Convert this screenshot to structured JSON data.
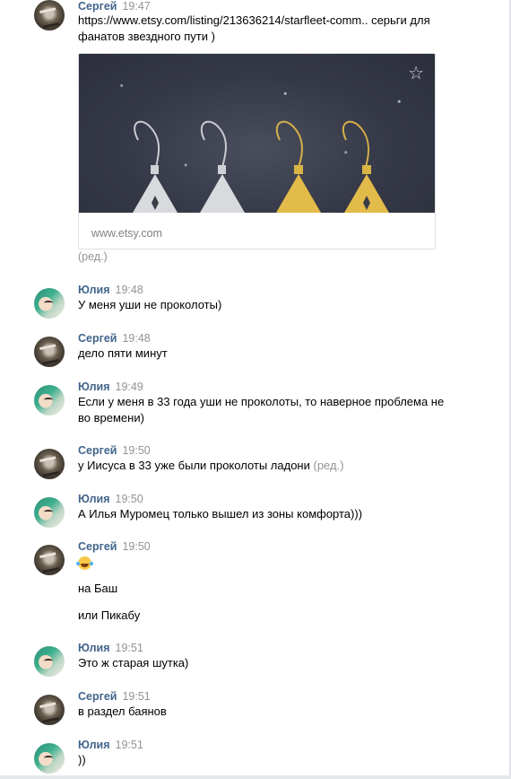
{
  "messages": [
    {
      "author": "Сергей",
      "time": "19:47",
      "lines": [
        "https://www.etsy.com/listing/213636214/starfleet-comm.. серьги для",
        "фанатов звездного пути )"
      ],
      "card": {
        "domain": "www.etsy.com",
        "icon": "star-outline-icon"
      },
      "edited": "(ред.)"
    },
    {
      "author": "Юлия",
      "time": "19:48",
      "lines": [
        "У меня уши не проколоты)"
      ]
    },
    {
      "author": "Сергей",
      "time": "19:48",
      "lines": [
        "дело пяти минут"
      ]
    },
    {
      "author": "Юлия",
      "time": "19:49",
      "lines": [
        "Если у меня в 33 года уши не проколоты, то наверное проблема не",
        "во времени)"
      ]
    },
    {
      "author": "Сергей",
      "time": "19:50",
      "lines": [
        "у Иисуса в 33 уже были проколоты ладони"
      ],
      "edited": "(ред.)"
    },
    {
      "author": "Юлия",
      "time": "19:50",
      "lines": [
        "А Илья Муромец только вышел из зоны комфорта)))"
      ]
    },
    {
      "author": "Сергей",
      "time": "19:50",
      "emoji": "rofl-emoji",
      "lines": [
        "на Баш",
        "или Пикабу"
      ]
    },
    {
      "author": "Юлия",
      "time": "19:51",
      "lines": [
        "Это ж старая шутка)"
      ]
    },
    {
      "author": "Сергей",
      "time": "19:51",
      "lines": [
        "в раздел баянов"
      ]
    },
    {
      "author": "Юлия",
      "time": "19:51",
      "lines": [
        "))"
      ]
    }
  ],
  "colors": {
    "author": "#42648b",
    "time": "#939393",
    "text": "#000000"
  }
}
